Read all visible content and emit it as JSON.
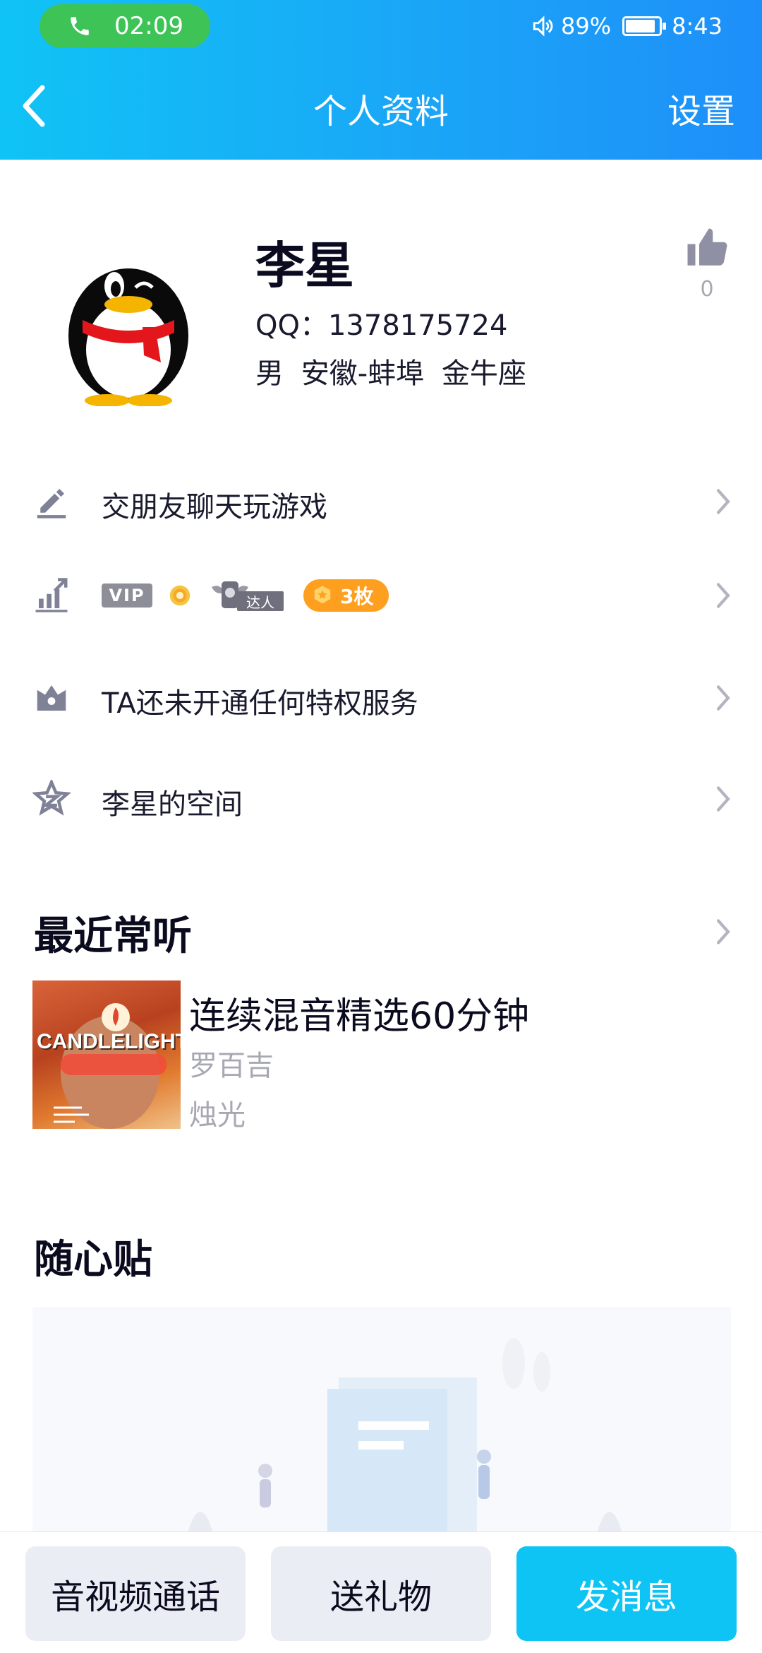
{
  "status": {
    "call_time": "02:09",
    "battery": "89%",
    "time": "8:43",
    "battery_level": 0.89
  },
  "nav": {
    "title": "个人资料",
    "settings": "设置"
  },
  "profile": {
    "name": "李星",
    "qq": "QQ：1378175724",
    "gender": "男",
    "location": "安徽-蚌埠",
    "zodiac": "金牛座",
    "likes": "0"
  },
  "rows": {
    "signature": "交朋友聊天玩游戏",
    "badges": {
      "vip": "VIP",
      "daren": "达人",
      "medal": "3枚"
    },
    "privilege": "TA还未开通任何特权服务",
    "space": "李星的空间"
  },
  "recent": {
    "title": "最近常听",
    "song": "连续混音精选60分钟",
    "artist": "罗百吉",
    "album": "烛光",
    "album_art_text": "CANDLELIGHT"
  },
  "notes": {
    "title": "随心贴"
  },
  "actions": {
    "call": "音视频通话",
    "gift": "送礼物",
    "message": "发消息"
  },
  "colors": {
    "header_start": "#10c3f5",
    "header_end": "#1e8ff9",
    "call_green": "#3ec456",
    "medal_orange": "#ff9f1f",
    "primary_button": "#0ec4f5"
  }
}
